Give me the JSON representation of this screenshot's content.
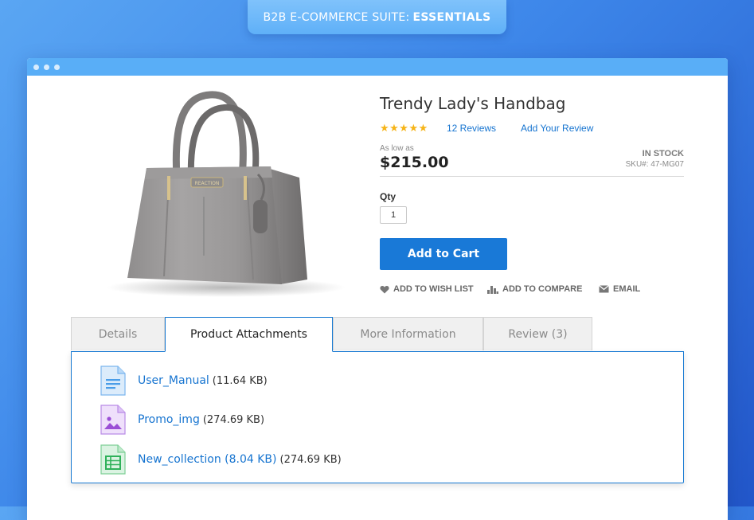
{
  "banner": {
    "prefix": "B2B E-COMMERCE SUITE:",
    "emphasis": "ESSENTIALS"
  },
  "product": {
    "title": "Trendy Lady's Handbag",
    "stars": "★★★★★",
    "reviews_link": "12 Reviews",
    "add_review_link": "Add Your Review",
    "price_caption": "As low as",
    "price": "$215.00",
    "stock_status": "IN STOCK",
    "sku": "SKU#: 47-MG07",
    "qty_label": "Qty",
    "qty_value": "1",
    "add_to_cart_label": "Add to Cart",
    "actions": {
      "wishlist": "ADD TO WISH LIST",
      "compare": "ADD TO COMPARE",
      "email": "EMAIL"
    },
    "image_brand_text": "REACTION"
  },
  "tabs": [
    {
      "label": "Details",
      "active": false
    },
    {
      "label": "Product Attachments",
      "active": true
    },
    {
      "label": "More Information",
      "active": false
    },
    {
      "label": "Review (3)",
      "active": false
    }
  ],
  "attachments": [
    {
      "name": "User_Manual",
      "size": "(11.64 KB)",
      "icon": "document-icon",
      "color": "#4a9de8"
    },
    {
      "name": "Promo_img",
      "size": "(274.69 KB)",
      "icon": "image-icon",
      "color": "#9b4fd6"
    },
    {
      "name": "New_collection (8.04 KB)",
      "size": "(274.69 KB)",
      "icon": "spreadsheet-icon",
      "color": "#2fb15a"
    }
  ],
  "colors": {
    "accent": "#1979d7",
    "link": "#1674d0",
    "star": "#f6b418",
    "background_gradient_start": "#5aa6f3",
    "background_gradient_end": "#2256c9"
  }
}
